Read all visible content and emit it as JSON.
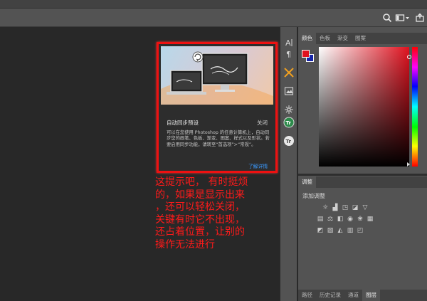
{
  "toolbar": {
    "icons": [
      "search-icon",
      "workspace-icon",
      "share-icon"
    ]
  },
  "panel_tabs_top": [
    {
      "label": "颜色",
      "active": true
    },
    {
      "label": "色板",
      "active": false
    },
    {
      "label": "渐变",
      "active": false
    },
    {
      "label": "图案",
      "active": false
    }
  ],
  "color": {
    "foreground": "#e0121f",
    "background": "#1625a8"
  },
  "adjustments": {
    "tab": "调整",
    "title": "添加调整"
  },
  "panel_tabs_bottom": [
    {
      "label": "路径",
      "active": false
    },
    {
      "label": "历史记录",
      "active": false
    },
    {
      "label": "通道",
      "active": false
    },
    {
      "label": "图层",
      "active": true
    }
  ],
  "popup": {
    "title": "自动同步预设",
    "close": "关闭",
    "body": "可以在您使用 Photoshop 的任意计算机上，自动同步您的画笔、色板、渐变、图案、样式以及形状。若要启用同步功能，请转至“首选项”>“常规”。",
    "link": "了解详情"
  },
  "annotation": {
    "text": "这提示吧，有时挺烦的，如果是显示出来，还可以轻松关闭，关键有时它不出现，还占着位置，让别的操作无法进行",
    "lines": [
      "这提示吧，  有时挺烦",
      "的，如果是显示出来",
      "，还可以轻松关闭，",
      "关键有时它不出现，",
      "还占着位置，让别的",
      "操作无法进行"
    ]
  }
}
